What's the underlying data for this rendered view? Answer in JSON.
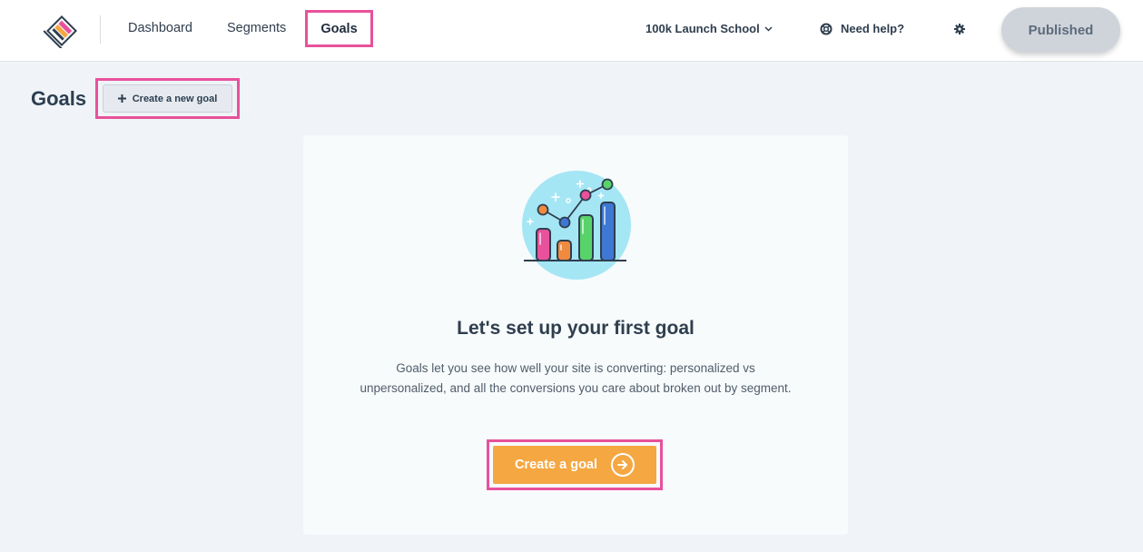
{
  "nav": {
    "dashboard": "Dashboard",
    "segments": "Segments",
    "goals": "Goals",
    "workspace": "100k Launch School",
    "help": "Need help?",
    "publish": "Published"
  },
  "page": {
    "title": "Goals",
    "new_goal": "Create a new goal"
  },
  "empty_state": {
    "heading": "Let's set up your first goal",
    "description_line1": "Goals let you see how well your site is converting: personalized vs",
    "description_line2": "unpersonalized, and all the conversions you care about broken out by segment.",
    "cta": "Create a goal"
  },
  "colors": {
    "highlight": "#e8519b",
    "cta": "#f5a742",
    "published_bg": "#cfd4db"
  },
  "icons": {
    "logo": "logo-icon",
    "workspace_chevron": "chevron-down-icon",
    "help": "lifebuoy-icon",
    "settings": "gear-icon",
    "plus": "plus-icon",
    "arrow": "arrow-right-icon",
    "illustration": "bar-chart-illustration"
  }
}
